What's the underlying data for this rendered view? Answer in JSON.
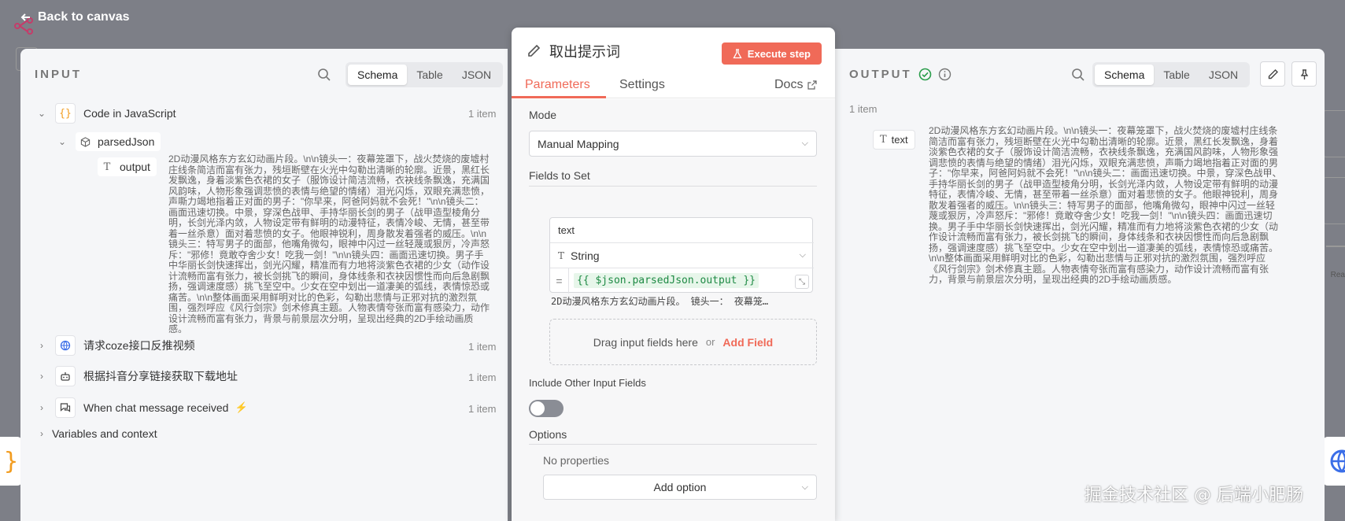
{
  "back_label": "Back to canvas",
  "input": {
    "title": "INPUT",
    "view_tabs": [
      "Schema",
      "Table",
      "JSON"
    ],
    "nodes": [
      {
        "name": "Code in JavaScript",
        "count": "1 item"
      },
      {
        "name": "请求coze接口反推视频",
        "count": "1 item"
      },
      {
        "name": "根据抖音分享链接获取下载地址",
        "count": "1 item"
      },
      {
        "name": "When chat message received",
        "count": "1 item"
      }
    ],
    "parsed_json_label": "parsedJson",
    "output_label": "output",
    "output_text": "2D动漫风格东方玄幻动画片段。\\n\\n镜头一：夜幕笼罩下，战火焚烧的废墟村庄线条简洁而富有张力，残垣断壁在火光中勾勒出清晰的轮廓。近景，黑红长发飘逸，身着淡紫色衣裙的女子（服饰设计简洁流畅，衣袂线条飘逸，充满国风韵味，人物形象强调悲愤的表情与绝望的情绪）泪光闪烁，双眼充满悲愤，声嘶力竭地指着正对面的男子：\"你早来，阿爸阿妈就不会死！\"\\n\\n镜头二：画面迅速切换。中景，穿深色战甲、手持华丽长剑的男子（战甲造型棱角分明，长剑光泽内敛，人物设定带有鲜明的动漫特征，表情冷峻、无情，甚至带着一丝杀意）面对着悲愤的女子。他眼神锐利，周身散发着强者的威压。\\n\\n镜头三：特写男子的面部，他嘴角微勾，眼神中闪过一丝轻蔑或狠厉，冷声怒斥：\"邪修！竟敢夺舍少女！吃我一剑！\"\\n\\n镜头四：画面迅速切换。男子手中华丽长剑快速挥出，剑光闪耀，精准而有力地将淡紫色衣裙的少女（动作设计流畅而富有张力，被长剑挑飞的瞬间，身体线条和衣袂因惯性而向后急剧飘扬，强调速度感）挑飞至空中。少女在空中划出一道凄美的弧线，表情惊恐或痛苦。\\n\\n整体画面采用鲜明对比的色彩，勾勒出悲情与正邪对抗的激烈氛围，强烈呼应《风行剑宗》剑术修真主题。人物表情夸张而富有感染力，动作设计流畅而富有张力，背景与前景层次分明，呈现出经典的2D手绘动画质感。",
    "variables_label": "Variables and context"
  },
  "center": {
    "title": "取出提示词",
    "execute_label": "Execute step",
    "tabs": {
      "parameters": "Parameters",
      "settings": "Settings",
      "docs": "Docs"
    },
    "mode_label": "Mode",
    "mode_value": "Manual Mapping",
    "fields_label": "Fields to Set",
    "field_name": "text",
    "field_type": "String",
    "field_expression": "{{ $json.parsedJson.output }}",
    "field_preview": "2D动漫风格东方玄幻动画片段。 镜头一： 夜幕笼…",
    "drag_text": "Drag input fields here",
    "or_text": "or",
    "add_field": "Add Field",
    "include_label": "Include Other Input Fields",
    "options_label": "Options",
    "no_properties": "No properties",
    "add_option": "Add option"
  },
  "output": {
    "title": "OUTPUT",
    "count": "1 item",
    "view_tabs": [
      "Schema",
      "Table",
      "JSON"
    ],
    "field_label": "text",
    "text": "2D动漫风格东方玄幻动画片段。\\n\\n镜头一：夜幕笼罩下，战火焚烧的废墟村庄线条简洁而富有张力，残垣断壁在火光中勾勒出清晰的轮廓。近景，黑红长发飘逸，身着淡紫色衣裙的女子（服饰设计简洁流畅，衣袂线条飘逸，充满国风韵味，人物形象强调悲愤的表情与绝望的情绪）泪光闪烁，双眼充满悲愤，声嘶力竭地指着正对面的男子：\"你早来，阿爸阿妈就不会死！\"\\n\\n镜头二：画面迅速切换。中景，穿深色战甲、手持华丽长剑的男子（战甲造型棱角分明，长剑光泽内敛，人物设定带有鲜明的动漫特征，表情冷峻、无情，甚至带着一丝杀意）面对着悲愤的女子。他眼神锐利，周身散发着强者的威压。\\n\\n镜头三：特写男子的面部，他嘴角微勾，眼神中闪过一丝轻蔑或狠厉，冷声怒斥：\"邪修！竟敢夺舍少女！吃我一剑！\"\\n\\n镜头四：画面迅速切换。男子手中华丽长剑快速挥出，剑光闪耀，精准而有力地将淡紫色衣裙的少女（动作设计流畅而富有张力，被长剑挑飞的瞬间，身体线条和衣袂因惯性而向后急剧飘扬，强调速度感）挑飞至空中。少女在空中划出一道凄美的弧线，表情惊恐或痛苦。\\n\\n整体画面采用鲜明对比的色彩，勾勒出悲情与正邪对抗的激烈氛围，强烈呼应《风行剑宗》剑术修真主题。人物表情夸张而富有感染力，动作设计流畅而富有张力，背景与前景层次分明，呈现出经典的2D手绘动画质感。"
  },
  "watermark": "掘金技术社区 @ 后端小肥肠",
  "colors": {
    "accent": "#f06a58",
    "success": "#2a9d4b"
  },
  "icons": [
    "back-arrow-icon",
    "search-icon",
    "braces-icon",
    "cube-icon",
    "text-type-icon",
    "globe-icon",
    "robot-icon",
    "chat-icon",
    "lightning-icon",
    "pencil-icon",
    "flask-icon",
    "external-link-icon",
    "check-circle-icon",
    "info-icon",
    "pin-icon"
  ]
}
